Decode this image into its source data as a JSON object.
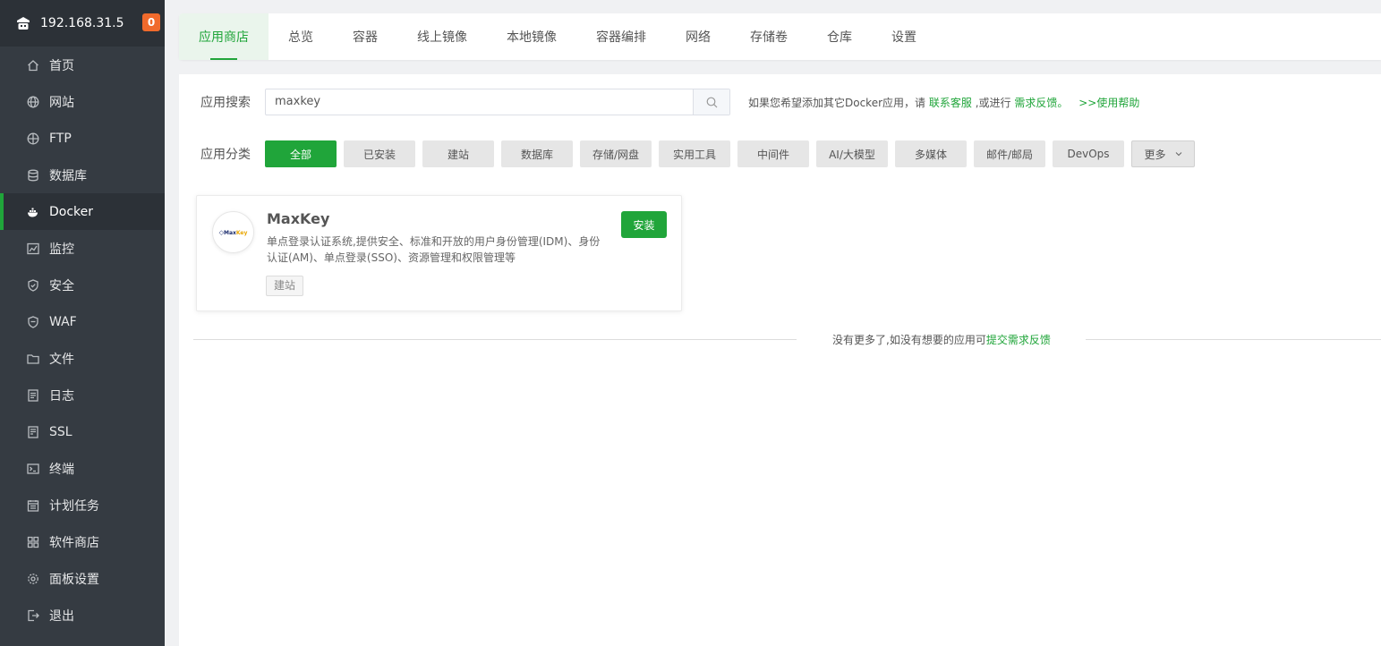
{
  "sidebar": {
    "server_ip": "192.168.31.5",
    "notification_count": "0",
    "items": [
      {
        "label": "首页",
        "icon": "home-icon"
      },
      {
        "label": "网站",
        "icon": "globe-icon"
      },
      {
        "label": "FTP",
        "icon": "ftp-globe-icon"
      },
      {
        "label": "数据库",
        "icon": "database-icon"
      },
      {
        "label": "Docker",
        "icon": "docker-icon",
        "active": true
      },
      {
        "label": "监控",
        "icon": "monitor-icon"
      },
      {
        "label": "安全",
        "icon": "shield-icon"
      },
      {
        "label": "WAF",
        "icon": "waf-shield-icon"
      },
      {
        "label": "文件",
        "icon": "folder-icon"
      },
      {
        "label": "日志",
        "icon": "log-icon"
      },
      {
        "label": "SSL",
        "icon": "ssl-icon"
      },
      {
        "label": "终端",
        "icon": "terminal-icon"
      },
      {
        "label": "计划任务",
        "icon": "calendar-icon"
      },
      {
        "label": "软件商店",
        "icon": "apps-grid-icon"
      },
      {
        "label": "面板设置",
        "icon": "gear-icon"
      },
      {
        "label": "退出",
        "icon": "logout-icon"
      }
    ]
  },
  "tabs": [
    "应用商店",
    "总览",
    "容器",
    "线上镜像",
    "本地镜像",
    "容器编排",
    "网络",
    "存储卷",
    "仓库",
    "设置"
  ],
  "active_tab": "应用商店",
  "search": {
    "label": "应用搜索",
    "value": "maxkey",
    "hint_prefix": "如果您希望添加其它Docker应用，请",
    "hint_link1": "联系客服",
    "hint_middle": ",或进行",
    "hint_link2": "需求反馈。",
    "help_link": ">>使用帮助"
  },
  "categories": {
    "label": "应用分类",
    "items": [
      "全部",
      "已安装",
      "建站",
      "数据库",
      "存储/网盘",
      "实用工具",
      "中间件",
      "AI/大模型",
      "多媒体",
      "邮件/邮局",
      "DevOps"
    ],
    "more_label": "更多"
  },
  "app_card": {
    "name": "MaxKey",
    "logo_text": "Max",
    "logo_text_accent": "Key",
    "description": "单点登录认证系统,提供安全、标准和开放的用户身份管理(IDM)、身份认证(AM)、单点登录(SSO)、资源管理和权限管理等",
    "tag": "建站",
    "install_label": "安装"
  },
  "footer": {
    "text": "没有更多了,如没有想要的应用可",
    "link": "提交需求反馈"
  },
  "colors": {
    "accent": "#20a53a",
    "sidebar_bg": "#353b42",
    "badge": "#f06a2c"
  }
}
